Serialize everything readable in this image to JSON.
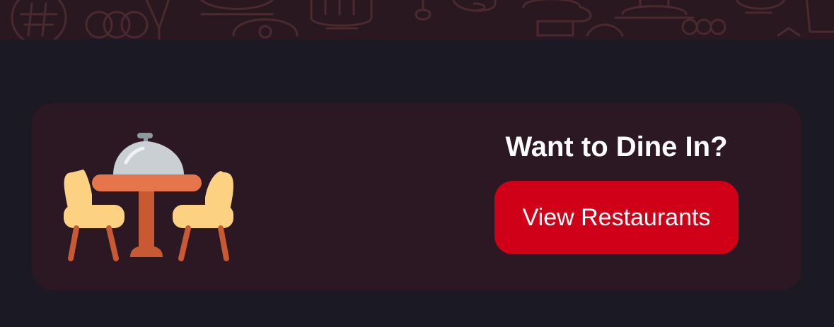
{
  "promo": {
    "title": "Want to Dine In?",
    "button_label": "View Restaurants"
  },
  "colors": {
    "page_background": "#1b1a24",
    "card_background": "#2b1822",
    "banner_background": "#2a1820",
    "banner_doodle": "#4a2a2e",
    "button": "#d10019",
    "title_text": "#ffffff"
  },
  "icons": {
    "banner_pattern": "food-doodle-pattern",
    "illustration": "dining-table-with-cloche-icon"
  }
}
